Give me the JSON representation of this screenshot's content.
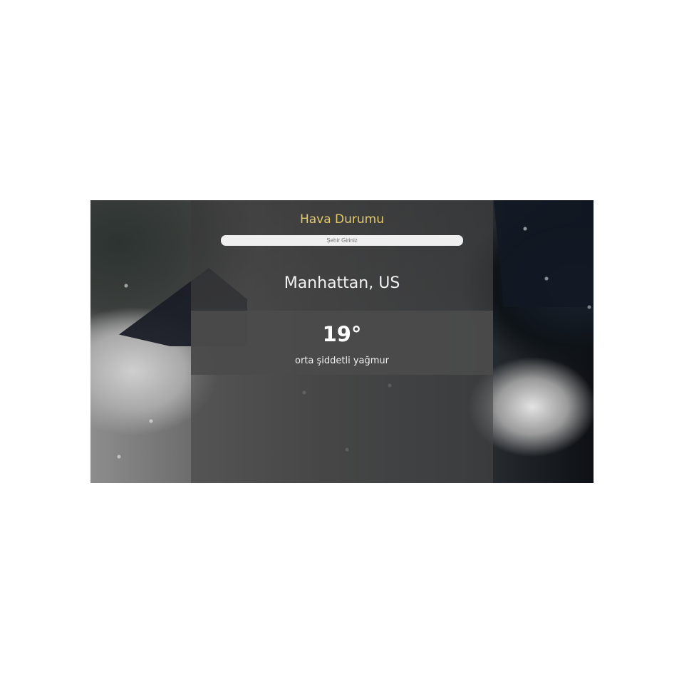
{
  "app": {
    "title": "Hava Durumu"
  },
  "search": {
    "placeholder": "Şehir Giriniz"
  },
  "location": {
    "city": "Manhattan, US"
  },
  "weather": {
    "temperature": "19°",
    "description": "orta şiddetli yağmur"
  },
  "colors": {
    "title_accent": "#e2c96a",
    "panel_overlay": "#464646"
  },
  "background": {
    "icon": "rainy-umbrella-photo"
  }
}
